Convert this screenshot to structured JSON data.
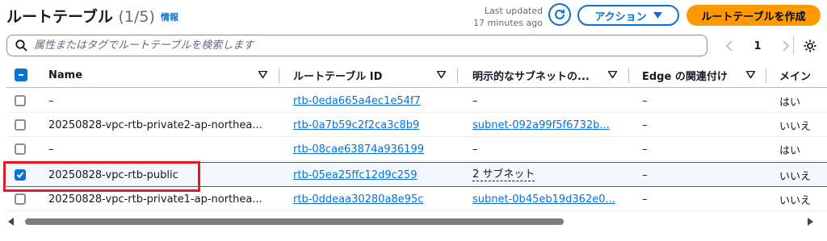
{
  "header": {
    "title": "ルートテーブル",
    "count": "(1/5)",
    "info_link": "情報",
    "last_updated_line1": "Last updated",
    "last_updated_line2": "17 minutes ago",
    "action_label": "アクション",
    "primary_label": "ルートテーブルを作成"
  },
  "search": {
    "placeholder": "属性またはタグでルートテーブルを検索します"
  },
  "pagination": {
    "current_page": "1"
  },
  "table": {
    "columns": {
      "name": "Name",
      "route_table_id": "ルートテーブル ID",
      "explicit_subnets": "明示的なサブネットの...",
      "edge_associations": "Edge の関連付け",
      "main": "メイン"
    },
    "rows": [
      {
        "name": "–",
        "id": "rtb-0eda665a4ec1e54f7",
        "subnet": "–",
        "edge": "–",
        "main": "はい",
        "selected": false
      },
      {
        "name": "20250828-vpc-rtb-private2-ap-northea...",
        "id": "rtb-0a7b59c2f2ca3c8b9",
        "subnet": "subnet-092a99f5f6732b...",
        "edge": "–",
        "main": "いいえ",
        "selected": false
      },
      {
        "name": "–",
        "id": "rtb-08cae63874a936199",
        "subnet": "–",
        "edge": "–",
        "main": "はい",
        "selected": false
      },
      {
        "name": "20250828-vpc-rtb-public",
        "id": "rtb-05ea25ffc12d9c259",
        "subnet": "2 サブネット",
        "edge": "–",
        "main": "いいえ",
        "selected": true
      },
      {
        "name": "20250828-vpc-rtb-private1-ap-northea...",
        "id": "rtb-0ddeaa30280a8e95c",
        "subnet": "subnet-0b45eb19d362e0...",
        "edge": "–",
        "main": "いいえ",
        "selected": false
      }
    ]
  },
  "colors": {
    "accent": "#0972d3",
    "primary_button": "#ff9900",
    "highlight_border": "#e01b24"
  }
}
